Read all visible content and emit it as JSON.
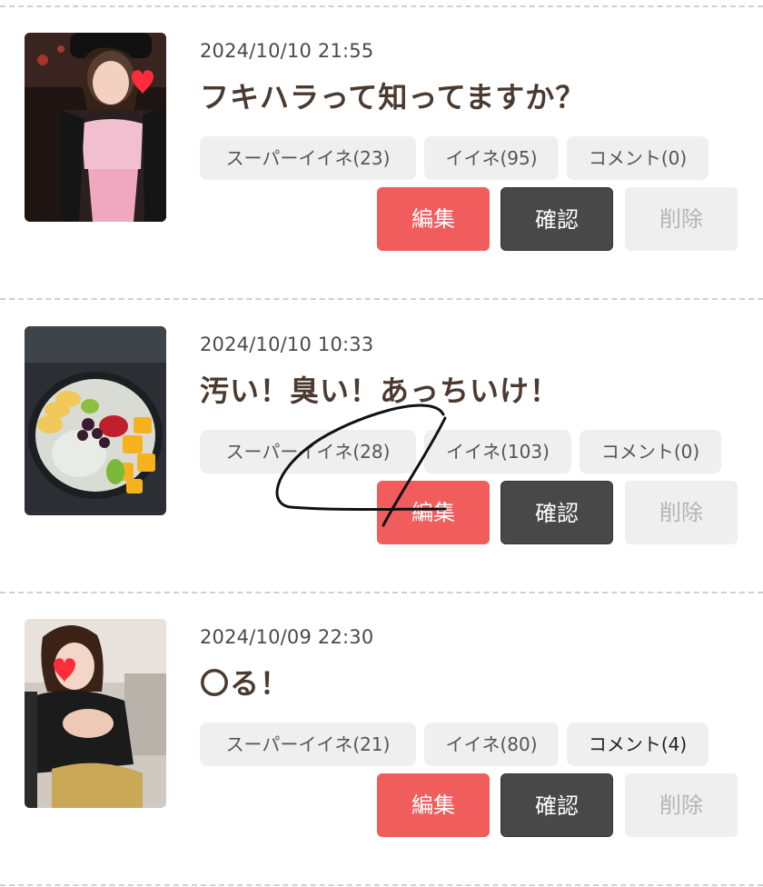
{
  "posts": [
    {
      "date": "2024/10/10 21:55",
      "title": "フキハラって知ってますか？",
      "stats": {
        "super_like": "スーパーイイネ(23)",
        "like": "イイネ(95)",
        "comment": "コメント(0)"
      },
      "buttons": {
        "edit": "編集",
        "confirm": "確認",
        "delete": "削除"
      }
    },
    {
      "date": "2024/10/10 10:33",
      "title": "汚い！臭い！あっちいけ！",
      "stats": {
        "super_like": "スーパーイイネ(28)",
        "like": "イイネ(103)",
        "comment": "コメント(0)"
      },
      "buttons": {
        "edit": "編集",
        "confirm": "確認",
        "delete": "削除"
      }
    },
    {
      "date": "2024/10/09 22:30",
      "title": "〇る！",
      "stats": {
        "super_like": "スーパーイイネ(21)",
        "like": "イイネ(80)",
        "comment": "コメント(4)"
      },
      "buttons": {
        "edit": "編集",
        "confirm": "確認",
        "delete": "削除"
      }
    }
  ],
  "colors": {
    "edit": "#f15c5c",
    "confirm": "#484848",
    "delete_bg": "#efefef",
    "stat_bg": "#efefef",
    "separator": "#cfcfcf"
  }
}
